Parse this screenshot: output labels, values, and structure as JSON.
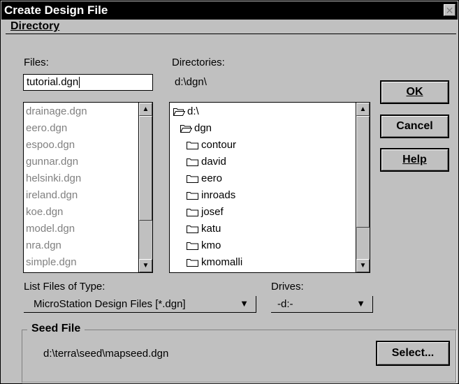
{
  "window": {
    "title": "Create Design File",
    "close_glyph": "✕"
  },
  "menu": {
    "directory_label": "Directory"
  },
  "files": {
    "label": "Files:",
    "input_value": "tutorial.dgn",
    "items": [
      "drainage.dgn",
      "eero.dgn",
      "espoo.dgn",
      "gunnar.dgn",
      "helsinki.dgn",
      "ireland.dgn",
      "koe.dgn",
      "model.dgn",
      "nra.dgn",
      "simple.dgn"
    ]
  },
  "directories": {
    "label": "Directories:",
    "current_path": "d:\\dgn\\",
    "items": [
      {
        "name": "d:\\",
        "icon": "open-folder-icon"
      },
      {
        "name": "dgn",
        "icon": "open-folder-icon"
      },
      {
        "name": "contour",
        "icon": "folder-icon"
      },
      {
        "name": "david",
        "icon": "folder-icon"
      },
      {
        "name": "eero",
        "icon": "folder-icon"
      },
      {
        "name": "inroads",
        "icon": "folder-icon"
      },
      {
        "name": "josef",
        "icon": "folder-icon"
      },
      {
        "name": "katu",
        "icon": "folder-icon"
      },
      {
        "name": "kmo",
        "icon": "folder-icon"
      },
      {
        "name": "kmomalli",
        "icon": "folder-icon"
      }
    ]
  },
  "file_type": {
    "label": "List Files of Type:",
    "selected": "MicroStation Design Files [*.dgn]"
  },
  "drives": {
    "label": "Drives:",
    "selected": "-d:-"
  },
  "buttons": {
    "ok": "OK",
    "cancel": "Cancel",
    "help": "Help",
    "select": "Select..."
  },
  "seed": {
    "label": "Seed File",
    "path": "d:\\terra\\seed\\mapseed.dgn"
  },
  "scroll": {
    "up_glyph": "▲",
    "down_glyph": "▼",
    "combo_glyph": "▼"
  }
}
